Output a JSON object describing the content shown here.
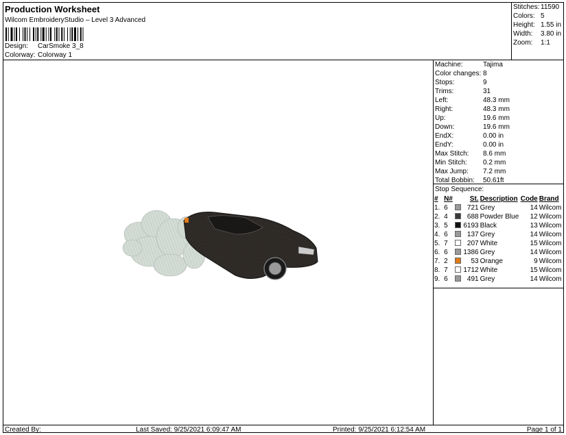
{
  "header": {
    "title": "Production Worksheet",
    "subtitle": "Wilcom EmbroideryStudio – Level 3 Advanced",
    "design_label": "Design:",
    "design_value": "CarSmoke 3_8",
    "colorway_label": "Colorway:",
    "colorway_value": "Colorway 1"
  },
  "stats": [
    {
      "label": "Stitches:",
      "value": "11590"
    },
    {
      "label": "Colors:",
      "value": "5"
    },
    {
      "label": "Height:",
      "value": "1.55 in"
    },
    {
      "label": "Width:",
      "value": "3.80 in"
    },
    {
      "label": "Zoom:",
      "value": "1:1"
    }
  ],
  "machine_info": [
    {
      "label": "Machine:",
      "value": "Tajima"
    },
    {
      "label": "Color changes:",
      "value": "8"
    },
    {
      "label": "Stops:",
      "value": "9"
    },
    {
      "label": "Trims:",
      "value": "31"
    },
    {
      "label": "Left:",
      "value": "48.3 mm"
    },
    {
      "label": "Right:",
      "value": "48.3 mm"
    },
    {
      "label": "Up:",
      "value": "19.6 mm"
    },
    {
      "label": "Down:",
      "value": "19.6 mm"
    },
    {
      "label": "EndX:",
      "value": "0.00 in"
    },
    {
      "label": "EndY:",
      "value": "0.00 in"
    },
    {
      "label": "Max Stitch:",
      "value": "8.6 mm"
    },
    {
      "label": "Min Stitch:",
      "value": "0.2 mm"
    },
    {
      "label": "Max Jump:",
      "value": "7.2 mm"
    },
    {
      "label": "Total Bobbin:",
      "value": "50.61ft"
    }
  ],
  "stop_sequence": {
    "label": "Stop Sequence:",
    "headers": {
      "num": "#",
      "n": "N#",
      "st": "St.",
      "desc": "Description",
      "code": "Code",
      "brand": "Brand"
    },
    "rows": [
      {
        "num": "1.",
        "n": "6",
        "color": "#9a9a9a",
        "st": "721",
        "desc": "Grey",
        "code": "14",
        "brand": "Wilcom"
      },
      {
        "num": "2.",
        "n": "4",
        "color": "#3a3a3a",
        "st": "688",
        "desc": "Powder Blue",
        "code": "12",
        "brand": "Wilcom"
      },
      {
        "num": "3.",
        "n": "5",
        "color": "#111111",
        "st": "6193",
        "desc": "Black",
        "code": "13",
        "brand": "Wilcom"
      },
      {
        "num": "4.",
        "n": "6",
        "color": "#9a9a9a",
        "st": "137",
        "desc": "Grey",
        "code": "14",
        "brand": "Wilcom"
      },
      {
        "num": "5.",
        "n": "7",
        "color": "#ffffff",
        "st": "207",
        "desc": "White",
        "code": "15",
        "brand": "Wilcom"
      },
      {
        "num": "6.",
        "n": "6",
        "color": "#9a9a9a",
        "st": "1386",
        "desc": "Grey",
        "code": "14",
        "brand": "Wilcom"
      },
      {
        "num": "7.",
        "n": "2",
        "color": "#e07b1a",
        "st": "53",
        "desc": "Orange",
        "code": "9",
        "brand": "Wilcom"
      },
      {
        "num": "8.",
        "n": "7",
        "color": "#ffffff",
        "st": "1712",
        "desc": "White",
        "code": "15",
        "brand": "Wilcom"
      },
      {
        "num": "9.",
        "n": "6",
        "color": "#9a9a9a",
        "st": "491",
        "desc": "Grey",
        "code": "14",
        "brand": "Wilcom"
      }
    ]
  },
  "footer": {
    "created_by": "Created By:",
    "last_saved": "Last Saved: 9/25/2021 6:09:47 AM",
    "printed": "Printed: 9/25/2021 6:12:54 AM",
    "page": "Page 1 of 1"
  },
  "colors": {
    "car_body": "#2a2623",
    "smoke": "#d4dcd6",
    "accent_orange": "#e07b1a"
  }
}
